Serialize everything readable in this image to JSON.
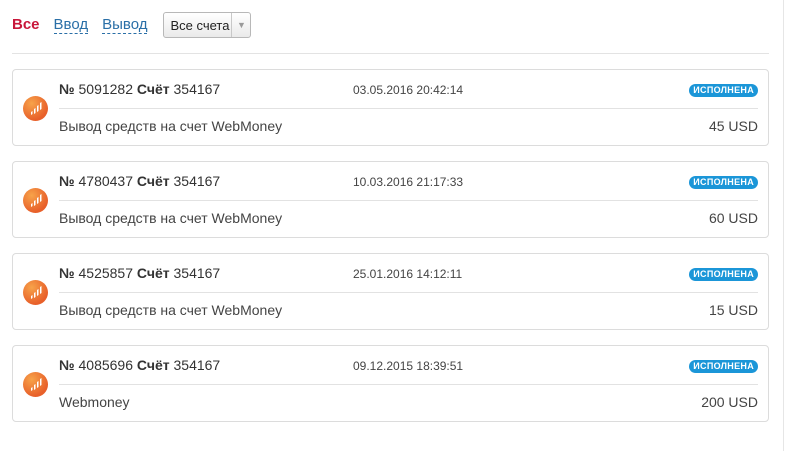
{
  "filters": {
    "all": "Все",
    "deposit": "Ввод",
    "withdraw": "Вывод"
  },
  "account_select": {
    "selected": "Все счета"
  },
  "labels": {
    "number_sign": "№",
    "account": "Счёт"
  },
  "transactions": [
    {
      "number": "5091282",
      "account": "354167",
      "date": "03.05.2016 20:42:14",
      "status": "исполнена",
      "description": "Вывод средств на счет WebMoney",
      "amount": "45 USD"
    },
    {
      "number": "4780437",
      "account": "354167",
      "date": "10.03.2016 21:17:33",
      "status": "исполнена",
      "description": "Вывод средств на счет WebMoney",
      "amount": "60 USD"
    },
    {
      "number": "4525857",
      "account": "354167",
      "date": "25.01.2016 14:12:11",
      "status": "исполнена",
      "description": "Вывод средств на счет WebMoney",
      "amount": "15 USD"
    },
    {
      "number": "4085696",
      "account": "354167",
      "date": "09.12.2015 18:39:51",
      "status": "исполнена",
      "description": "Webmoney",
      "amount": "200 USD"
    }
  ],
  "colors": {
    "active_filter": "#c8173a",
    "link": "#2a6fa7",
    "status_badge": "#1b96d8",
    "logo": "#e8602a"
  },
  "icons": {
    "logo": "broker-logo-icon",
    "select_arrow": "caret-down-icon"
  }
}
